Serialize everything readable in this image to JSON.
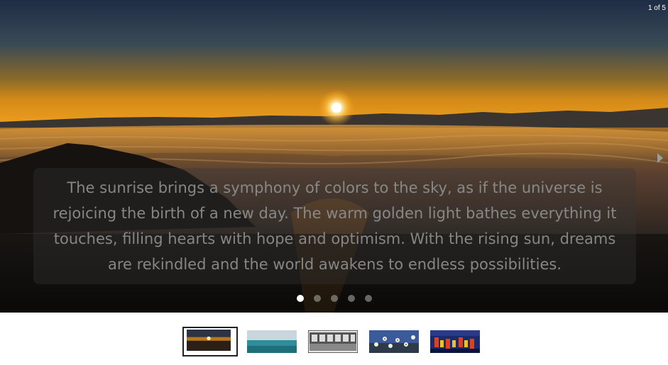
{
  "slider": {
    "counter": "1 of 5",
    "caption": "The sunrise brings a symphony of colors to the sky, as if the universe is rejoicing the birth of a new day. The warm golden light bathes everything it touches, filling hearts with hope and optimism. With the rising sun, dreams are rekindled and the world awakens to endless possibilities.",
    "current_slide": 1,
    "total_slides": 5,
    "next_icon": "chevron-right-icon"
  },
  "thumbnails": [
    {
      "name": "sunrise-thumbnail",
      "active": true
    },
    {
      "name": "sea-thumbnail",
      "active": false
    },
    {
      "name": "interior-thumbnail",
      "active": false
    },
    {
      "name": "blossom-thumbnail",
      "active": false
    },
    {
      "name": "stripes-thumbnail",
      "active": false
    }
  ],
  "colors": {
    "active_dot": "#ffffff",
    "inactive_dot": "#969696",
    "page_background": "#ffffff"
  }
}
